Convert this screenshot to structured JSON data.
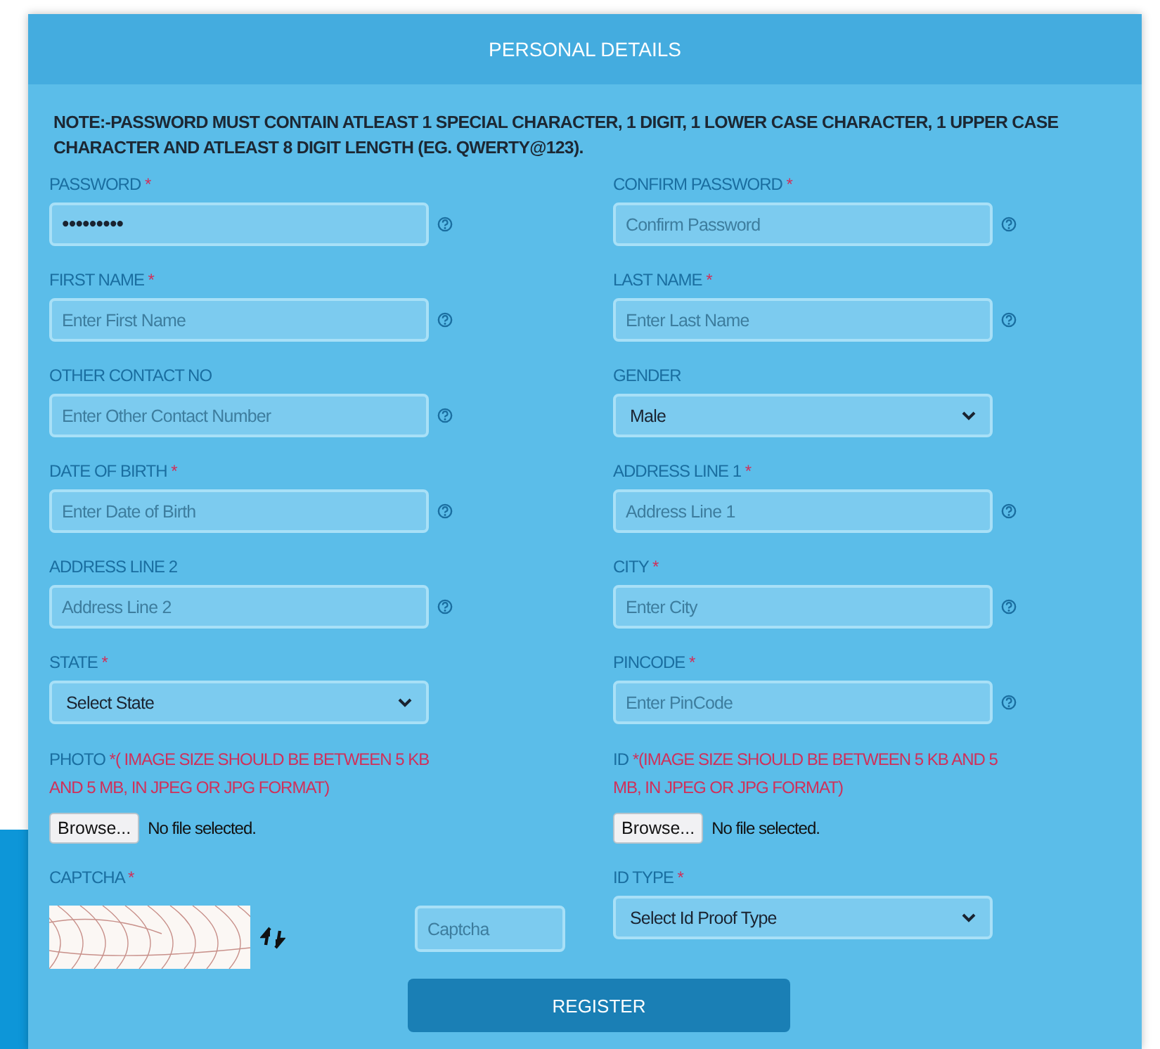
{
  "header": {
    "title": "PERSONAL DETAILS"
  },
  "note": "NOTE:-PASSWORD MUST CONTAIN ATLEAST 1 SPECIAL CHARACTER, 1 DIGIT, 1 LOWER CASE CHARACTER, 1 UPPER CASE CHARACTER AND ATLEAST 8 DIGIT LENGTH (EG. QWERTY@123).",
  "fields": [
    {
      "kind": "text",
      "label": "PASSWORD",
      "required": "*",
      "value": "•••••••••",
      "help": true
    },
    {
      "kind": "text",
      "label": "CONFIRM PASSWORD",
      "required": "*",
      "placeholder": "Confirm Password",
      "help": true
    },
    {
      "kind": "text",
      "label": "FIRST NAME",
      "required": "*",
      "placeholder": "Enter First Name",
      "help": true
    },
    {
      "kind": "text",
      "label": "LAST NAME",
      "required": "*",
      "placeholder": "Enter Last Name",
      "help": true
    },
    {
      "kind": "text",
      "label": "OTHER CONTACT NO",
      "placeholder": "Enter Other Contact Number",
      "help": true
    },
    {
      "kind": "select",
      "label": "GENDER",
      "value": "Male"
    },
    {
      "kind": "text",
      "label": "DATE OF BIRTH",
      "required": "*",
      "placeholder": "Enter Date of Birth",
      "help": true
    },
    {
      "kind": "text",
      "label": "ADDRESS LINE 1",
      "required": "*",
      "placeholder": "Address Line 1",
      "help": true
    },
    {
      "kind": "text",
      "label": "ADDRESS LINE 2",
      "placeholder": "Address Line 2",
      "help": true
    },
    {
      "kind": "text",
      "label": "CITY",
      "required": "*",
      "placeholder": "Enter City",
      "help": true
    },
    {
      "kind": "select",
      "label": "STATE",
      "required": "*",
      "value": "Select State"
    },
    {
      "kind": "text",
      "label": "PINCODE",
      "required": "*",
      "placeholder": "Enter PinCode",
      "help": true
    },
    {
      "kind": "file",
      "label": "PHOTO",
      "required": "*",
      "note": "( IMAGE SIZE SHOULD BE BETWEEN 5 KB AND 5 MB, IN JPEG OR JPG FORMAT)",
      "button": "Browse...",
      "status": "No file selected."
    },
    {
      "kind": "file",
      "label": "ID",
      "required": "*",
      "note": "(IMAGE SIZE SHOULD BE BETWEEN 5 KB AND 5 MB, IN JPEG OR JPG FORMAT)",
      "button": "Browse...",
      "status": "No file selected."
    },
    {
      "kind": "captcha",
      "label": "CAPTCHA",
      "required": "*",
      "placeholder": "Captcha"
    },
    {
      "kind": "select",
      "label": "ID TYPE",
      "required": "*",
      "value": "Select Id Proof Type"
    }
  ],
  "submit": {
    "label": "REGISTER"
  }
}
